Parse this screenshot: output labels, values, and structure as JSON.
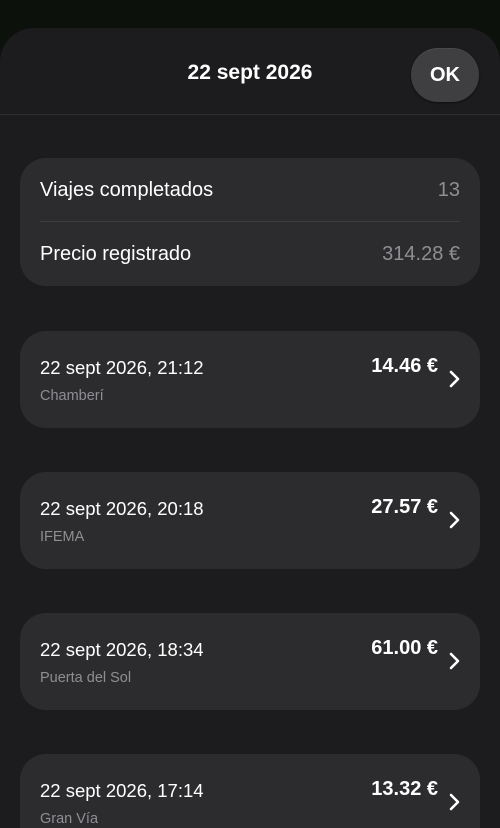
{
  "header": {
    "title": "22 sept 2026",
    "ok_label": "OK"
  },
  "summary": {
    "rows": [
      {
        "label": "Viajes completados",
        "value": "13"
      },
      {
        "label": "Precio registrado",
        "value": "314.28 €"
      }
    ]
  },
  "trips": [
    {
      "datetime": "22 sept 2026, 21:12",
      "place": "Chamberí",
      "price": "14.46 €"
    },
    {
      "datetime": "22 sept 2026, 20:18",
      "place": "IFEMA",
      "price": "27.57 €"
    },
    {
      "datetime": "22 sept 2026, 18:34",
      "place": "Puerta del Sol",
      "price": "61.00 €"
    },
    {
      "datetime": "22 sept 2026, 17:14",
      "place": "Gran Vía",
      "price": "13.32 €"
    }
  ],
  "icons": {
    "trip_row": "chevron-right-icon"
  },
  "colors": {
    "background": "#1c1c1e",
    "card": "#2c2c2e",
    "secondary_text": "#8e8e93",
    "button": "#3f3f41"
  }
}
